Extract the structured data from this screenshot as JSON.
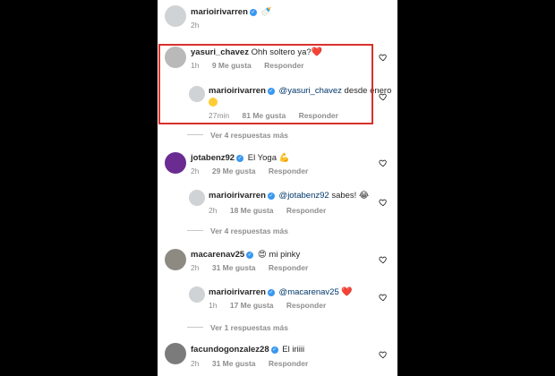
{
  "post_author": {
    "username": "marioirivarren",
    "caption_emoji": "🍼",
    "time": "2h"
  },
  "comments": [
    {
      "username": "yasuri_chavez",
      "verified": false,
      "text": "Ohh soltero ya?",
      "emoji": "❤️",
      "time": "1h",
      "likes": "9 Me gusta",
      "reply_label": "Responder",
      "reply": {
        "username": "marioirivarren",
        "mention": "@yasuri_chavez",
        "text": " desde enero",
        "time": "27min",
        "likes": "81 Me gusta",
        "reply_label": "Responder"
      },
      "view_more": "Ver 4 respuestas más"
    },
    {
      "username": "jotabenz92",
      "verified": true,
      "text": "El Yoga",
      "emoji": "💪",
      "time": "2h",
      "likes": "29 Me gusta",
      "reply_label": "Responder",
      "reply": {
        "username": "marioirivarren",
        "mention": "@jotabenz92",
        "text": " sabes!",
        "emoji": "😂",
        "time": "2h",
        "likes": "18 Me gusta",
        "reply_label": "Responder"
      },
      "view_more": "Ver 4 respuestas más"
    },
    {
      "username": "macarenav25",
      "verified": true,
      "text": "mi pinky",
      "emoji": "😍",
      "time": "2h",
      "likes": "31 Me gusta",
      "reply_label": "Responder",
      "reply": {
        "username": "marioirivarren",
        "mention": "@macarenav25",
        "text": "",
        "emoji": "❤️",
        "time": "1h",
        "likes": "17 Me gusta",
        "reply_label": "Responder"
      },
      "view_more": "Ver 1 respuestas más"
    },
    {
      "username": "facundogonzalez28",
      "verified": true,
      "text": "El iriiii",
      "time": "2h",
      "likes": "31 Me gusta",
      "reply_label": "Responder"
    }
  ],
  "colors": {
    "highlight": "#d9302b",
    "verified": "#3897f0",
    "heart": "#ed4956"
  }
}
